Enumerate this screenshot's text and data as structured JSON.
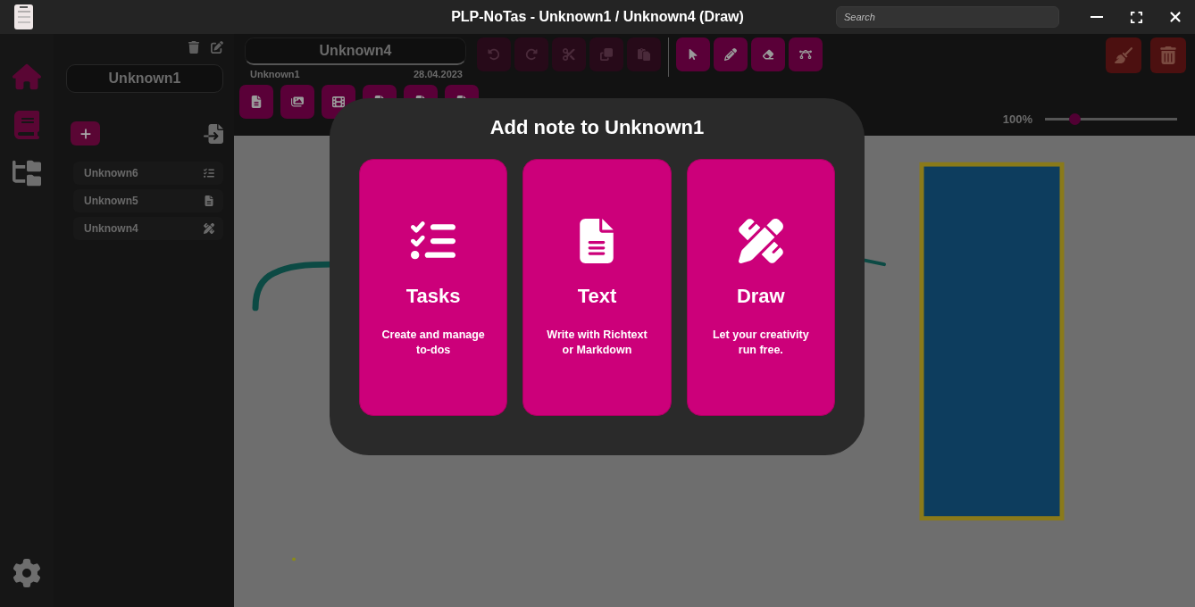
{
  "window": {
    "title": "PLP-NoTas - Unknown1 / Unknown4 (Draw)",
    "search": {
      "placeholder": "Search"
    }
  },
  "rail": {
    "items": [
      {
        "kind": "home",
        "selected": true
      },
      {
        "kind": "notebooks",
        "selected": true
      },
      {
        "kind": "tree",
        "selected": false
      }
    ]
  },
  "notebook": {
    "name": "Unknown1",
    "notes": [
      {
        "title": "Unknown6",
        "kind": "tasks"
      },
      {
        "title": "Unknown5",
        "kind": "text"
      },
      {
        "title": "Unknown4",
        "kind": "draw"
      }
    ]
  },
  "note": {
    "title": "Unknown4",
    "notebook": "Unknown1",
    "date": "28.04.2023"
  },
  "attachments": [
    {
      "kind": "document"
    },
    {
      "kind": "images"
    },
    {
      "kind": "film"
    },
    {
      "kind": "document"
    },
    {
      "kind": "document"
    },
    {
      "kind": "document"
    }
  ],
  "tools": [
    {
      "kind": "undo",
      "disabled": true
    },
    {
      "kind": "redo",
      "disabled": true
    },
    {
      "kind": "cut",
      "disabled": true
    },
    {
      "kind": "copy",
      "disabled": true
    },
    {
      "kind": "paste",
      "disabled": true
    },
    {
      "kind": "separator"
    },
    {
      "kind": "select",
      "disabled": false
    },
    {
      "kind": "pen",
      "disabled": false
    },
    {
      "kind": "eraser",
      "disabled": false
    },
    {
      "kind": "bezier",
      "disabled": false
    }
  ],
  "zoom": {
    "reading": "100%",
    "level": 0.22
  },
  "dialog": {
    "title": "Add note to Unknown1",
    "options": [
      {
        "kind": "tasks",
        "title": "Tasks",
        "description": "Create and manage to-dos"
      },
      {
        "kind": "text",
        "title": "Text",
        "description": "Write with Richtext or Markdown"
      },
      {
        "kind": "draw",
        "title": "Draw",
        "description": "Let your creativity run free."
      }
    ]
  }
}
